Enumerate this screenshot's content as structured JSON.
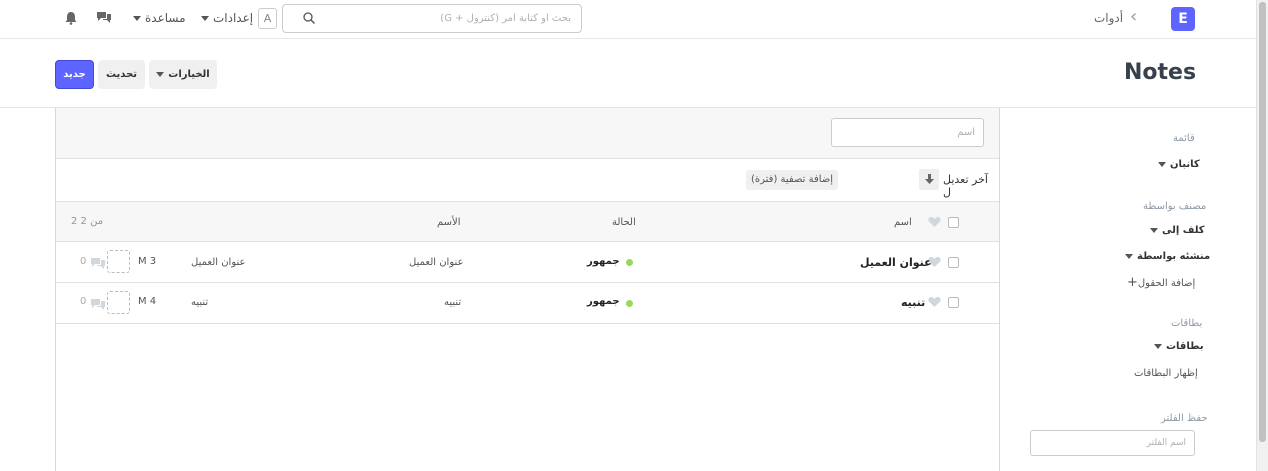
{
  "app": {
    "logo_letter": "E"
  },
  "navbar": {
    "breadcrumb": "أدوات",
    "search_placeholder": "بحث أو كتابة أمر (كنترول + G)",
    "avatar_letter": "A",
    "settings_label": "إعدادات",
    "help_label": "مساعدة"
  },
  "page": {
    "title": "Notes"
  },
  "toolbar": {
    "new_label": "جديد",
    "refresh_label": "تحديث",
    "options_label": "الخيارات"
  },
  "list": {
    "name_filter_placeholder": "اسم",
    "sort_label": "آخر تعديل ل",
    "add_filter_label": "إضافة تصفية (فترة)",
    "headers": {
      "name": "اسم",
      "status": "الحالة",
      "title": "الأسم",
      "count": "2 من 2"
    },
    "rows": [
      {
        "name": "عنوان العميل",
        "status": "جمهور",
        "title": "عنوان العميل",
        "subject": "عنوان العميل",
        "modified": "M 3",
        "comments": "0"
      },
      {
        "name": "تنبيه",
        "status": "جمهور",
        "title": "تنبيه",
        "subject": "تنبيه",
        "modified": "M 4",
        "comments": "0"
      }
    ],
    "status_color": "#98d85b"
  },
  "sidebar": {
    "list_heading": "قائمة",
    "kanban_label": "كانبان",
    "group_by_heading": "مصنف بواسطة",
    "assigned_to_label": "كلف إلى",
    "created_by_label": "منشئه بواسطة",
    "add_fields_label": "إضافة الحقول",
    "tags_heading": "بطاقات",
    "tags_label": "بطاقات",
    "show_tags_label": "إظهار البطاقات",
    "save_filter_heading": "حفظ الفلتر",
    "filter_name_placeholder": "اسم الفلتر"
  },
  "colors": {
    "primary": "#5e64ff"
  }
}
